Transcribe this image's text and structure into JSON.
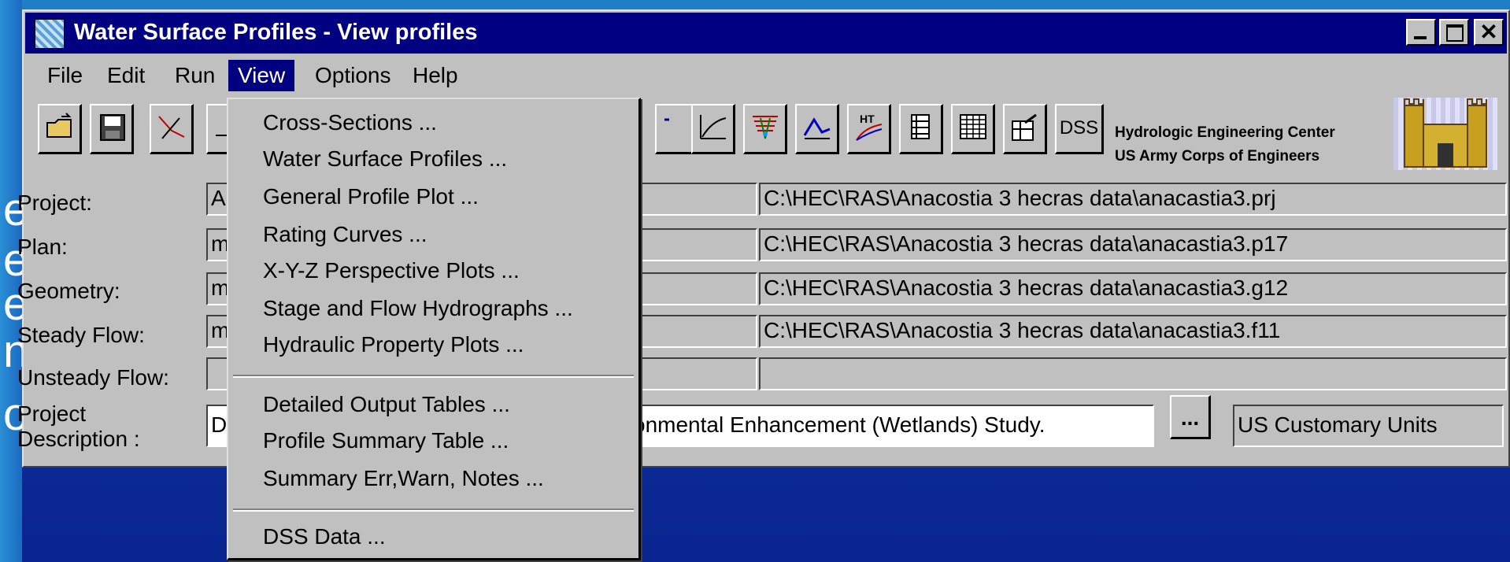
{
  "window": {
    "title": "Water Surface Profiles - View profiles"
  },
  "menubar": {
    "file": "File",
    "edit": "Edit",
    "run": "Run",
    "view": "View",
    "options": "Options",
    "help": "Help"
  },
  "toolbar": {
    "buttons": [
      "open-folder-icon",
      "save-disk-icon",
      "geometry-icon",
      "flow-icon",
      "cross-section-plot-icon",
      "profile-plot-icon",
      "xyz-plot-icon",
      "general-profile-icon",
      "rating-curve-icon",
      "hydraulic-table-icon",
      "detailed-table-icon",
      "summary-table-icon",
      "dss-icon"
    ],
    "dss_label": "DSS"
  },
  "organization": {
    "line1": "Hydrologic Engineering Center",
    "line2": "US Army Corps of Engineers"
  },
  "fields": {
    "project": {
      "label": "Project:",
      "value_short": "A",
      "path": "C:\\HEC\\RAS\\Anacostia 3 hecras data\\anacastia3.prj"
    },
    "plan": {
      "label": "Plan:",
      "value_short": "m",
      "path": "C:\\HEC\\RAS\\Anacostia 3 hecras data\\anacastia3.p17"
    },
    "geometry": {
      "label": "Geometry:",
      "value_short": "m",
      "path": "C:\\HEC\\RAS\\Anacostia 3 hecras data\\anacastia3.g12"
    },
    "steady_flow": {
      "label": "Steady Flow:",
      "value_short": "m",
      "path": "C:\\HEC\\RAS\\Anacostia 3 hecras data\\anacastia3.f11"
    },
    "unsteady_flow": {
      "label": "Unsteady Flow:",
      "value_short": "",
      "path": ""
    },
    "description": {
      "label_line1": "Project",
      "label_line2": "Description :",
      "value_short": "D",
      "value": "onmental Enhancement (Wetlands) Study.",
      "button": "...",
      "units": "US Customary Units"
    }
  },
  "view_menu": {
    "group1": [
      "Cross-Sections ...",
      "Water Surface Profiles ...",
      "General Profile Plot ...",
      "Rating Curves ...",
      "X-Y-Z Perspective Plots ...",
      "Stage and Flow Hydrographs ...",
      "Hydraulic Property Plots ..."
    ],
    "group2": [
      "Detailed Output Tables ...",
      "Profile Summary Table ...",
      "Summary Err,Warn, Notes ..."
    ],
    "group3": [
      "DSS Data ..."
    ]
  },
  "background_text": [
    "e",
    "e",
    "e",
    "n",
    "o"
  ]
}
